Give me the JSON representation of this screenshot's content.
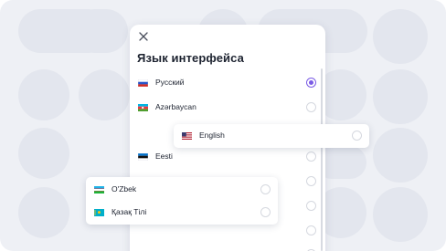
{
  "dialog": {
    "title": "Язык интерфейса",
    "languages": [
      {
        "label": "Русский",
        "flag": "ru-flag",
        "selected": true
      },
      {
        "label": "Azərbaycan",
        "flag": "az-flag",
        "selected": false
      },
      {
        "label": "Eesti",
        "flag": "ee-flag",
        "selected": false
      }
    ]
  },
  "popups": {
    "english": {
      "label": "English",
      "flag": "us-flag"
    },
    "uzbek": {
      "label": "O'Zbek",
      "flag": "uz-flag"
    },
    "kazakh": {
      "label": "Қазақ Тілі",
      "flag": "kz-flag"
    }
  },
  "colors": {
    "accent": "#7b5ce5",
    "background": "#eef0f5"
  }
}
